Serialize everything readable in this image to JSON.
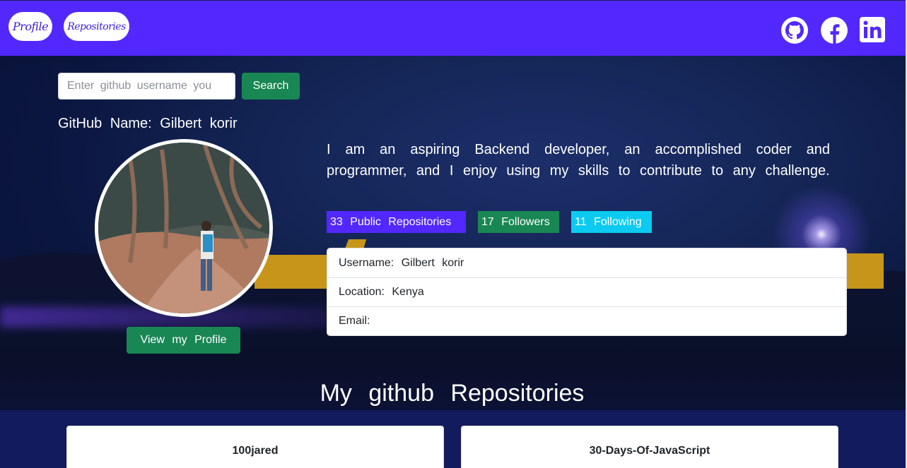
{
  "nav": {
    "profile_label": "Profile",
    "repos_label": "Repositories",
    "social": [
      "github-icon",
      "facebook-icon",
      "linkedin-icon"
    ]
  },
  "search": {
    "placeholder": "Enter github username you",
    "button_label": "Search"
  },
  "profile": {
    "github_name_text": "GitHub Name: Gilbert korir",
    "view_profile_label": "View my Profile",
    "bio": "I am an aspiring Backend developer, an accomplished coder and programmer, and I enjoy using my skills to contribute to any challenge."
  },
  "stats": {
    "repos_text": "33 Public Repositories",
    "followers_text": "17 Followers",
    "following_text": "11 Following"
  },
  "info": {
    "username": "Username: Gilbert korir",
    "location": "Location: Kenya",
    "email": "Email:"
  },
  "repos_section": {
    "title": "My github Repositories",
    "cards": [
      "100jared",
      "30-Days-Of-JavaScript"
    ]
  },
  "colors": {
    "primary": "#5228ff",
    "success": "#198754",
    "info": "#0dcaf0"
  }
}
